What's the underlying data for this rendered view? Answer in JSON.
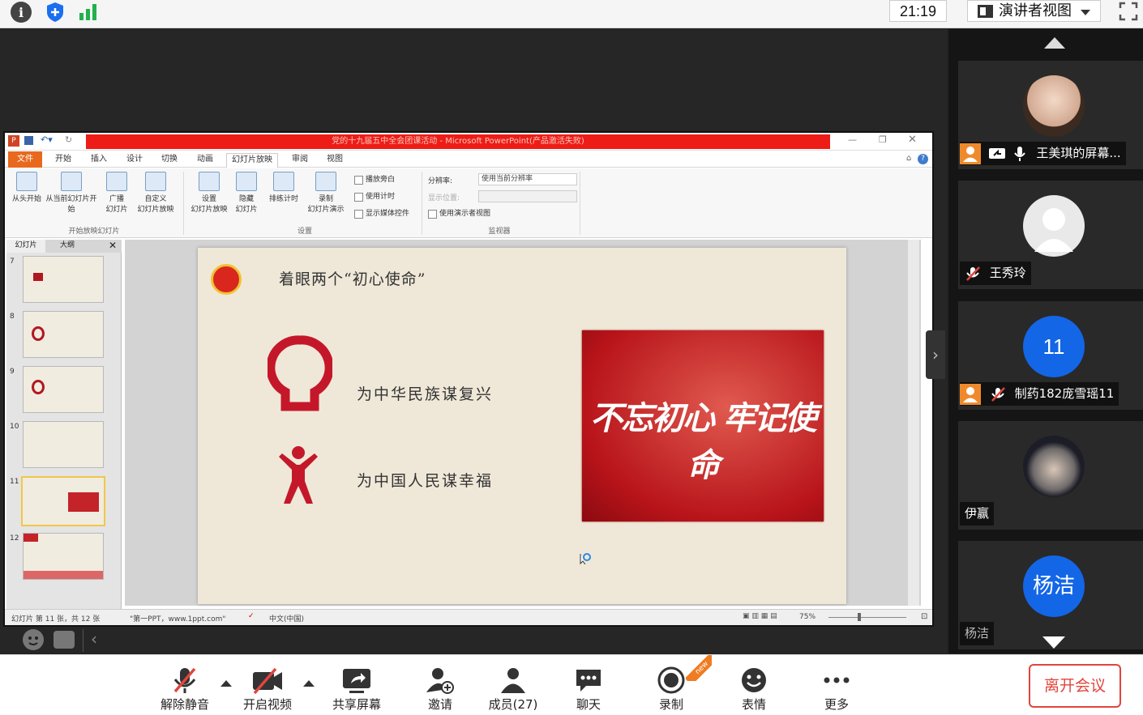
{
  "topbar": {
    "time": "21:19",
    "view_label": "演讲者视图"
  },
  "ppt": {
    "window_title": "党的十九届五中全会团课活动 - Microsoft PowerPoint(产品激活失败)",
    "tabs": [
      "文件",
      "开始",
      "插入",
      "设计",
      "切换",
      "动画",
      "幻灯片放映",
      "审阅",
      "视图"
    ],
    "ribbon": {
      "from_start": "从头开始",
      "from_current": "从当前幻灯片开始",
      "broadcast": "广播\n幻灯片",
      "custom": "自定义\n幻灯片放映",
      "group1": "开始放映幻灯片",
      "setup": "设置\n幻灯片放映",
      "hide": "隐藏\n幻灯片",
      "rehearse": "排练计时",
      "record": "录制\n幻灯片演示",
      "play_narration": "播放旁白",
      "use_timing": "使用计时",
      "show_media": "显示媒体控件",
      "group2": "设置",
      "resolution_label": "分辨率:",
      "resolution_value": "使用当前分辨率",
      "display_label": "显示位置:",
      "presenter_view": "使用演示者视图",
      "group3": "监视器"
    },
    "panel_tabs": [
      "幻灯片",
      "大纲"
    ],
    "thumbnails": [
      "7",
      "8",
      "9",
      "10",
      "11",
      "12"
    ],
    "slide": {
      "title": "着眼两个“初心使命”",
      "item1": "为中华民族谋复兴",
      "item2": "为中国人民谋幸福",
      "image_caption": "不忘初心 牢记使命"
    },
    "status": {
      "slide_info": "幻灯片 第 11 张，共 12 张",
      "theme": "\"第一PPT，www.1ppt.com\"",
      "language": "中文(中国)",
      "zoom": "75%"
    }
  },
  "participants": [
    {
      "name": "王美琪的屏幕...",
      "muted": false,
      "sharing": true
    },
    {
      "name": "王秀玲",
      "muted": true
    },
    {
      "name": "制药182庞雪瑶11",
      "avatar_text": "11",
      "muted": true
    },
    {
      "name": "伊赢"
    },
    {
      "name": "杨洁",
      "avatar_text": "杨洁"
    }
  ],
  "toolbar": {
    "unmute": "解除静音",
    "start_video": "开启视频",
    "share_screen": "共享屏幕",
    "invite": "邀请",
    "members": "成员(27)",
    "chat": "聊天",
    "record": "录制",
    "record_badge": "new",
    "reactions": "表情",
    "more": "更多",
    "leave": "离开会议"
  },
  "colors": {
    "accent_blue": "#1366e6",
    "leave_red": "#e0453d",
    "ppt_red": "#ee1c16",
    "ppt_orange": "#e8691e"
  }
}
